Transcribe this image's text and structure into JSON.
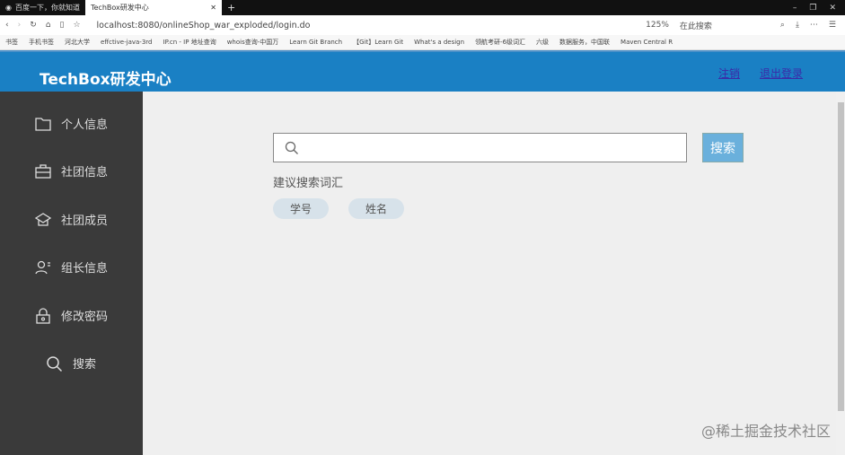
{
  "browser": {
    "tabs": [
      {
        "title": "百度一下，你就知道"
      },
      {
        "title": "TechBox研发中心"
      }
    ],
    "new_tab": "+",
    "url": "localhost:8080/onlineShop_war_exploded/login.do",
    "zoom": "125%",
    "search_placeholder": "在此搜索",
    "bookmarks": [
      "书签",
      "手机书签",
      "河北大学",
      "effctive-java-3rd",
      "IP.cn - IP 地址查询",
      "whois查询-中国万",
      "Learn Git Branch",
      "【Git】Learn Git",
      "What's a design",
      "领航考研-6级词汇",
      "六级",
      "数据服务，中国联",
      "Maven Central R"
    ]
  },
  "header": {
    "title": "TechBox研发中心",
    "links": [
      "注销",
      "退出登录"
    ]
  },
  "sidebar": {
    "items": [
      {
        "label": "个人信息",
        "icon": "folder-icon"
      },
      {
        "label": "社团信息",
        "icon": "briefcase-icon"
      },
      {
        "label": "社团成员",
        "icon": "graduation-cap-icon"
      },
      {
        "label": "组长信息",
        "icon": "user-icon"
      },
      {
        "label": "修改密码",
        "icon": "lock-icon"
      },
      {
        "label": "搜索",
        "icon": "search-icon"
      }
    ]
  },
  "main": {
    "search_value": "",
    "search_button": "搜索",
    "suggest_label": "建议搜索词汇",
    "chips": [
      "学号",
      "姓名"
    ]
  },
  "watermark": "@稀土掘金技术社区"
}
